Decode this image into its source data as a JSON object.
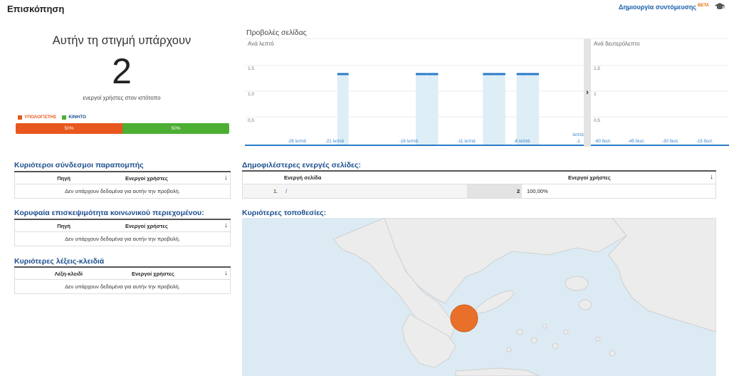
{
  "header": {
    "title": "Επισκόπηση",
    "shortcut_label": "Δημιουργία συντόμευσης",
    "beta_label": "BETA"
  },
  "active_users": {
    "heading": "Αυτήν τη στιγμή υπάρχουν",
    "count": "2",
    "subtitle": "ενεργοί χρήστες στον ιστότοπο",
    "legend": [
      {
        "label": "ΥΠΟΛΟΓΙΣΤΗΣ",
        "color": "#e8571e"
      },
      {
        "label": "ΚΙΝΗΤΟ",
        "color": "#4caf33"
      }
    ],
    "segments": [
      {
        "label": "50%",
        "share": 0.5,
        "color": "#e8571e"
      },
      {
        "label": "50%",
        "share": 0.5,
        "color": "#4caf33"
      }
    ]
  },
  "pageviews": {
    "title": "Προβολές σελίδας",
    "per_minute_label": "Ανά λεπτό",
    "per_second_label": "Ανά δευτερόλεπτο",
    "minute_y_ticks": [
      "1,5",
      "1,0",
      "0,5"
    ],
    "second_y_ticks": [
      "1,5",
      "1",
      "0,5"
    ],
    "minute_x_labels": [
      "-26 λεπτά",
      "-21 λεπτά",
      "-16 λεπτά",
      "-11 λεπτά",
      "-6 λεπτά",
      "-1"
    ],
    "minute_x_suffix": "λεπτό",
    "second_x_labels": [
      "-60 δευτ.",
      "-45 δευτ.",
      "-30 δευτ.",
      "-15 δευτ."
    ],
    "expand_arrow": "›",
    "accent_color": "#2a7bc8",
    "bar_fill": "#ddeef7"
  },
  "chart_data": {
    "type": "area",
    "title": "Προβολές σελίδας",
    "xlabel": "Ανά λεπτό",
    "ylim": [
      0,
      1.5
    ],
    "x": [
      -30,
      -29,
      -28,
      -27,
      -26,
      -25,
      -24,
      -23,
      -22,
      -21,
      -20,
      -19,
      -18,
      -17,
      -16,
      -15,
      -14,
      -13,
      -12,
      -11,
      -10,
      -9,
      -8,
      -7,
      -6,
      -5,
      -4,
      -3,
      -2,
      -1
    ],
    "series": [
      {
        "values": [
          0,
          0,
          0,
          0,
          0,
          0,
          0,
          0,
          1,
          0,
          0,
          0,
          0,
          0,
          0,
          1,
          1,
          0,
          0,
          0,
          0,
          1,
          1,
          0,
          1,
          1,
          0,
          0,
          0,
          0
        ]
      }
    ],
    "per_second_values": []
  },
  "referrals": {
    "title": "Κυριότεροι σύνδεσμοι παραπομπής",
    "col1": "Πηγή",
    "col2": "Ενεργοί χρήστες",
    "empty": "Δεν υπάρχουν δεδομένα για αυτήν την προβολή."
  },
  "social": {
    "title": "Κορυφαία επισκεψιμότητα κοινωνικού περιεχομένου:",
    "col1": "Πηγή",
    "col2": "Ενεργοί χρήστες",
    "empty": "Δεν υπάρχουν δεδομένα για αυτήν την προβολή."
  },
  "keywords": {
    "title": "Κυριότερες λέξεις-κλειδιά",
    "col1": "Λέξη-κλειδί",
    "col2": "Ενεργοί χρήστες",
    "empty": "Δεν υπάρχουν δεδομένα για αυτήν την προβολή."
  },
  "pages": {
    "title": "Δημοφιλέστερες ενεργές σελίδες:",
    "col1": "Ενεργή σελίδα",
    "col2": "Ενεργοί χρήστες",
    "rows": [
      {
        "index": "1.",
        "page": "/",
        "users": "2",
        "percent": "100,00%",
        "share": 1.0
      }
    ]
  },
  "locations": {
    "title": "Κυριότερες τοποθεσίες:",
    "land_color": "#ececec",
    "water_color": "#dcebf3",
    "marker_color": "#e8702a"
  },
  "sort_arrow": "↓"
}
